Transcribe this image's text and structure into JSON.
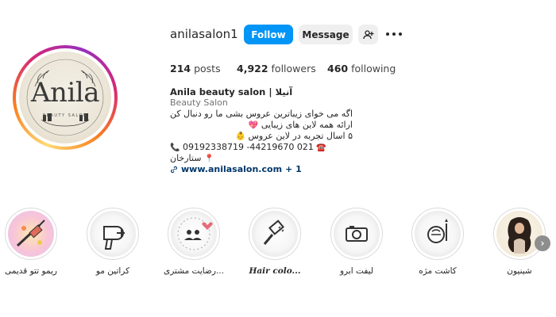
{
  "profile": {
    "username": "anilasalon1",
    "avatar": {
      "logo_text": "Anila",
      "logo_sub": "BEAUTY SALON"
    },
    "actions": {
      "follow_label": "Follow",
      "message_label": "Message",
      "add_user_icon": "add-user-icon",
      "more_icon": "more-horizontal-icon"
    },
    "accent_color": "#0095f6"
  },
  "stats": {
    "posts": {
      "count": "214",
      "label": "posts"
    },
    "followers": {
      "count": "4,922",
      "label": "followers"
    },
    "following": {
      "count": "460",
      "label": "following"
    }
  },
  "bio": {
    "name": "Anila beauty salon | آنیلا",
    "category": "Beauty Salon",
    "line1": "اگه می خوای زیباترین عروس بشی ما رو دنبال کن",
    "line2": "ارائه همه لاین های زیبایی",
    "line2_emoji": "💖",
    "line3": "۵ اسال تجربه در لاین عروس",
    "line3_emoji": "👶",
    "line4": "09192338719 -44219670 021",
    "line4_emoji_left": "📞",
    "line4_emoji_right": "☎️",
    "line5": "ستارخان",
    "line5_emoji": "📍",
    "link_icon": "link-icon",
    "link": "www.anilasalon.com",
    "link_more": "+ 1"
  },
  "highlights": [
    {
      "label": "ریمو تتو قدیمی",
      "icon": "tattoo-remove-icon"
    },
    {
      "label": "کراتین مو",
      "icon": "hair-dryer-icon"
    },
    {
      "label": "رضایت مشتری...",
      "icon": "customer-satisfaction-icon"
    },
    {
      "label": "Hair colo...",
      "icon": "hair-color-brush-icon"
    },
    {
      "label": "لیفت ابرو",
      "icon": "eyebrow-lift-icon"
    },
    {
      "label": "کاشت مژه",
      "icon": "eyelash-extension-icon"
    },
    {
      "label": "شینیون",
      "icon": "hairstyle-portrait-icon"
    }
  ],
  "nav": {
    "next_icon": "chevron-right-icon",
    "next_glyph": "›"
  }
}
